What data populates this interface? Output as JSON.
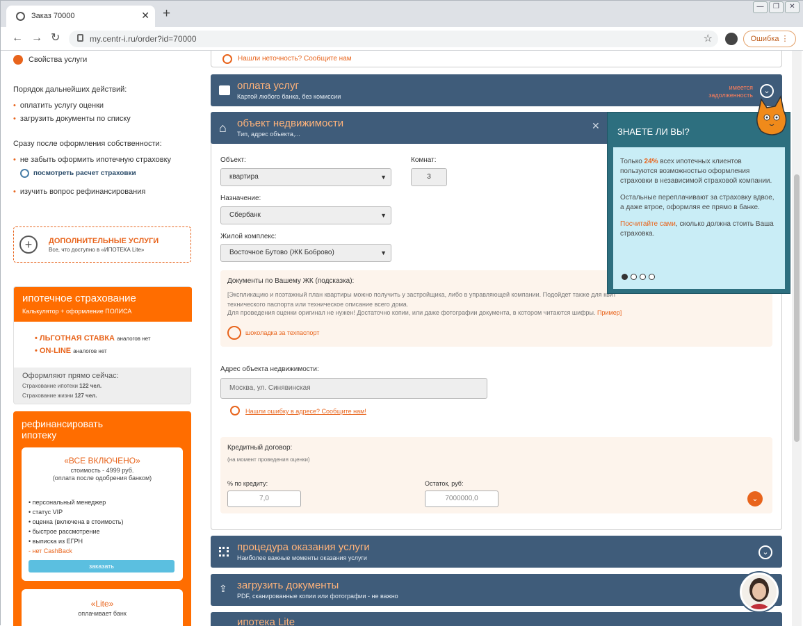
{
  "browser": {
    "tab_title": "Заказ 70000",
    "url": "my.centr-i.ru/order?id=70000",
    "error_label": "Ошибка"
  },
  "colors": {
    "accent": "#e8641c",
    "panel": "#3f5c7a",
    "popup": "#2d6f7f"
  },
  "sidebar": {
    "props_link": "Свойства услуги",
    "next_title": "Порядок дальнейших действий:",
    "next_items": [
      "оплатить услугу оценки",
      "загрузить документы по списку"
    ],
    "after_title": "Сразу после оформления собственности:",
    "after_item1": "не забыть оформить ипотечную страховку",
    "after_calc": "посмотреть расчет страховки",
    "after_item2": "изучить вопрос рефинансирования",
    "extra_title": "ДОПОЛНИТЕЛЬНЫЕ УСЛУГИ",
    "extra_sub": "Все, что доступно в «ИПОТЕКА Lite»",
    "ins_title": "ипотечное страхование",
    "ins_sub": "Калькулятор + оформление ПОЛИСА",
    "ins_b1": "ЛЬГОТНАЯ СТАВКА",
    "ins_b1s": "аналогов нет",
    "ins_b2": "ON-LINE",
    "ins_b2s": "аналогов нет",
    "now_title": "Оформляют прямо сейчас:",
    "now_1": "Страхование ипотеки",
    "now_1v": "122 чел.",
    "now_2": "Страхование жизни",
    "now_2v": "127 чел.",
    "refi_title": "рефинансировать ипотеку",
    "refi_pkg": "«ВСЕ ВКЛЮЧЕНО»",
    "refi_cost": "стоимость - 4999 руб.",
    "refi_pay": "(оплата после одобрения банком)",
    "refi_feats": [
      "персональный менеджер",
      "статус VIP",
      "оценка (включена в стоимость)",
      "быстрое рассмотрение",
      "выписка из ЕГРН",
      "нет CashBack"
    ],
    "refi_btn": "заказать",
    "lite_title": "«Lite»",
    "lite_sub": "оплачивает банк"
  },
  "main": {
    "top_err": "Нашли неточность? Сообщите нам",
    "pay_title": "оплата услуг",
    "pay_sub": "Картой любого банка, без комиссии",
    "pay_status": "имеется задолженность",
    "obj_title": "объект недвижимости",
    "obj_sub": "Тип, адрес объекта,...",
    "obj_lbl": "Объект:",
    "obj_val": "квартира",
    "rooms_lbl": "Комнат:",
    "rooms_val": "3",
    "purp_lbl": "Назначение:",
    "purp_val": "Сбербанк",
    "complex_lbl": "Жилой комплекс:",
    "complex_val": "Восточное Бутово (ЖК Боброво)",
    "docs_title": "Документы по Вашему ЖК (подсказка):",
    "docs_l1": "[Экспликацию и поэтажный план квартиры можно получить у застройщика, либо в управляющей компании. Подойдет также для квит",
    "docs_l2": "технического паспорта или техническое описание всего дома.",
    "docs_l3": "Для проведения оценки оригинал не нужен! Достаточно копии, или даже фотографии документа, в котором читаются шифры.",
    "docs_ex": "Пример]",
    "docs_link": "шоколадка за техпаспорт",
    "addr_lbl": "Адрес объекта недвижимости:",
    "addr_val": "Москва, ул. Синявинская",
    "err_link": "Нашли ошибку в адресе? Сообщите нам!",
    "credit_title": "Кредитный договор:",
    "credit_sub": "(на момент проведения оценки)",
    "rate_lbl": "% по кредиту:",
    "rate_val": "7,0",
    "rest_lbl": "Остаток, руб:",
    "rest_val": "7000000,0",
    "proc_title": "процедура оказания услуги",
    "proc_sub": "Наиболее важные моменты оказания услуги",
    "upl_title": "загрузить документы",
    "upl_sub": "PDF, сканированные копии или фотографии - не важно",
    "last_title": "ипотека Lite"
  },
  "popup": {
    "title": "ЗНАЕТЕ ЛИ ВЫ?",
    "p1a": "Только ",
    "p1b": "24%",
    "p1c": " всех ипотечных клиентов пользуются возможностью оформления страховки в независимой страховой компании.",
    "p2": "Остальные переплачивают за страховку вдвое, а даже втрое, оформляя ее прямо в банке.",
    "p3a": "Посчитайте сами",
    "p3b": ", сколько должна стоить Ваша страховка.",
    "dots": 4,
    "active_dot": 0
  }
}
